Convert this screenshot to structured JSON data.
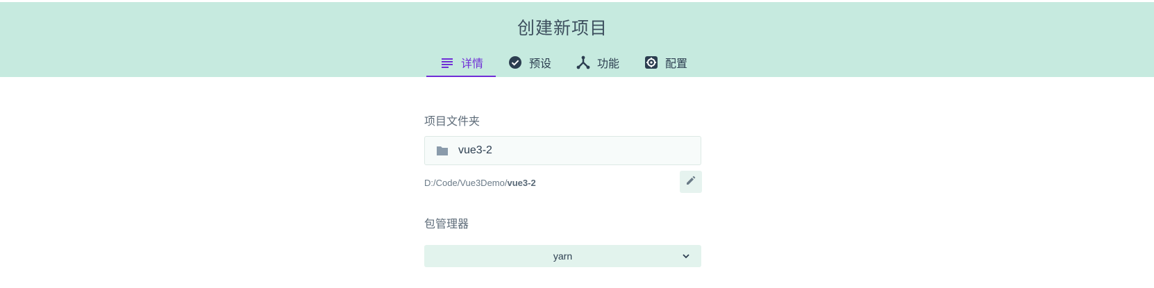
{
  "header": {
    "title": "创建新项目",
    "tabs": [
      {
        "label": "详情",
        "icon": "subject-icon",
        "active": true
      },
      {
        "label": "预设",
        "icon": "check-circle-icon",
        "active": false
      },
      {
        "label": "功能",
        "icon": "call-split-icon",
        "active": false
      },
      {
        "label": "配置",
        "icon": "settings-icon",
        "active": false
      }
    ]
  },
  "project_folder": {
    "label": "项目文件夹",
    "value": "vue3-2",
    "path_prefix": "D:/Code/Vue3Demo/",
    "path_name": "vue3-2",
    "edit_icon": "pencil-icon"
  },
  "package_manager": {
    "label": "包管理器",
    "selected": "yarn"
  },
  "colors": {
    "header_bg": "#c6eadf",
    "accent": "#6f2dd6",
    "text": "#2c3e50"
  }
}
